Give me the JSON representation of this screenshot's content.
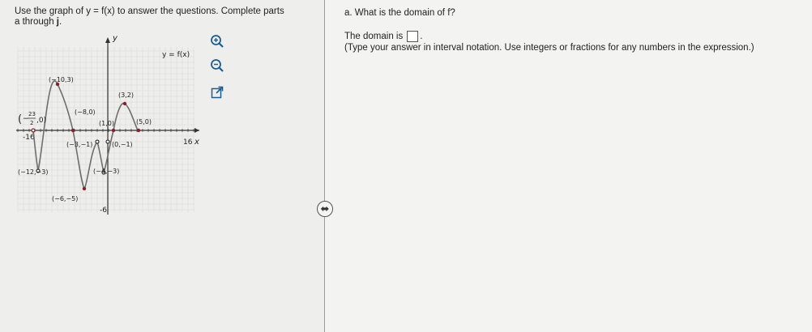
{
  "question": {
    "prefix": "Use the graph of y = f(x) to answer the questions. Complete parts a through ",
    "emph": "j",
    "suffix": "."
  },
  "graph": {
    "y_axis": "y",
    "x_axis": "x",
    "func_label": "y = f(x)",
    "x_ticks": {
      "left": "-16",
      "right": "16"
    },
    "y_tick_bottom": "-6",
    "points": [
      {
        "label": "(−10,3)"
      },
      {
        "label": "(−8,0)"
      },
      {
        "label": "(1,0)"
      },
      {
        "label": "(3,2)"
      },
      {
        "label": "(5,0)"
      },
      {
        "label": "(−3,−1)"
      },
      {
        "label": "(0,−1)"
      },
      {
        "label": "(−12,−3)"
      },
      {
        "label": "(−4,−3)"
      },
      {
        "label": "(−6,−5)"
      }
    ],
    "frac_point": {
      "open": "(",
      "minus": "−",
      "num": "23",
      "den": "2",
      "rest": ",0)"
    }
  },
  "tools": [
    {
      "name": "zoom-in-icon"
    },
    {
      "name": "zoom-out-icon"
    },
    {
      "name": "open-external-icon"
    }
  ],
  "colors": {
    "curve": "#6f6f6f",
    "point": "#8c1d2b",
    "accent": "#1b5e94"
  },
  "part_a": {
    "label": "a. What is the domain of f?",
    "domain_prefix": "The domain is",
    "period": ".",
    "hint": "(Type your answer in interval notation. Use integers or fractions for any numbers in the expression.)"
  }
}
